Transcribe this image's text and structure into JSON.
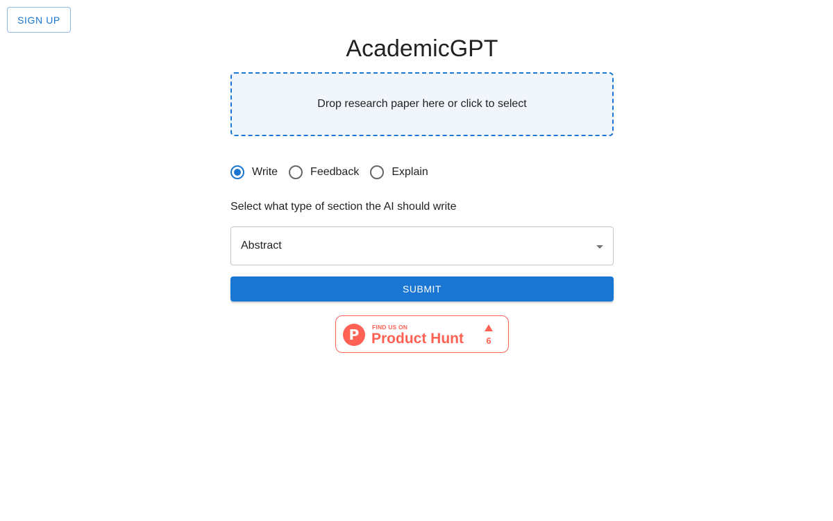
{
  "header": {
    "signup_label": "SIGN UP"
  },
  "main": {
    "title": "AcademicGPT",
    "dropzone_text": "Drop research paper here or click to select",
    "modes": [
      {
        "label": "Write",
        "checked": true
      },
      {
        "label": "Feedback",
        "checked": false
      },
      {
        "label": "Explain",
        "checked": false
      }
    ],
    "instruction": "Select what type of section the AI should write",
    "section_select": {
      "value": "Abstract"
    },
    "submit_label": "SUBMIT"
  },
  "product_hunt": {
    "logo_letter": "P",
    "tagline": "FIND US ON",
    "name": "Product Hunt",
    "upvotes": "6"
  },
  "colors": {
    "primary": "#1976d2",
    "dropzone_bg": "#f1f6fd",
    "product_hunt": "#ff6154"
  }
}
